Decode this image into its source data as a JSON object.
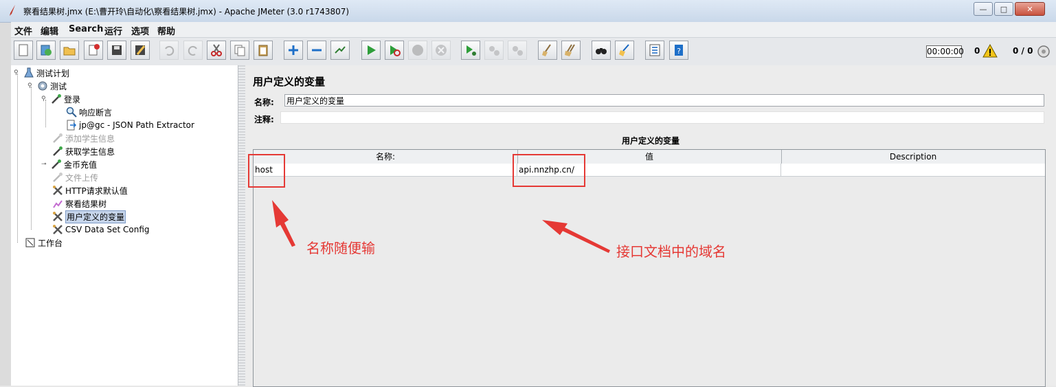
{
  "window": {
    "title": "察看结果树.jmx (E:\\曹开玲\\自动化\\察看结果树.jmx) - Apache JMeter (3.0 r1743807)",
    "buttons": {
      "minimize": "—",
      "maximize": "□",
      "close": "✕"
    }
  },
  "menu": [
    "文件",
    "编辑",
    "Search",
    "运行",
    "选项",
    "帮助"
  ],
  "toolbar": {
    "timer": "00:00:00",
    "warnings": "0",
    "threads": "0 / 0"
  },
  "tree": {
    "items": [
      {
        "label": "测试计划",
        "icon": "flask-icon",
        "enabled": true
      },
      {
        "label": "测试",
        "icon": "gear-icon",
        "enabled": true
      },
      {
        "label": "登录",
        "icon": "sampler-icon",
        "enabled": true
      },
      {
        "label": "响应断言",
        "icon": "magnifier-icon",
        "enabled": true
      },
      {
        "label": "jp@gc - JSON Path Extractor",
        "icon": "extractor-icon",
        "enabled": true
      },
      {
        "label": "添加学生信息",
        "icon": "sampler-icon",
        "enabled": false
      },
      {
        "label": "获取学生信息",
        "icon": "sampler-icon",
        "enabled": true
      },
      {
        "label": "金币充值",
        "icon": "sampler-icon",
        "enabled": true
      },
      {
        "label": "文件上传",
        "icon": "sampler-icon",
        "enabled": false
      },
      {
        "label": "HTTP请求默认值",
        "icon": "wrench-icon",
        "enabled": true
      },
      {
        "label": "察看结果树",
        "icon": "listener-icon",
        "enabled": true
      },
      {
        "label": "用户定义的变量",
        "icon": "wrench-icon",
        "enabled": true,
        "selected": true
      },
      {
        "label": "CSV Data Set Config",
        "icon": "wrench-icon",
        "enabled": true
      },
      {
        "label": "工作台",
        "icon": "workbench-icon",
        "enabled": true
      }
    ]
  },
  "panel": {
    "title": "用户定义的变量",
    "name_label": "名称:",
    "name_value": "用户定义的变量",
    "comment_label": "注释:",
    "comment_value": "",
    "table_title": "用户定义的变量",
    "columns": [
      "名称:",
      "值",
      "Description"
    ],
    "rows": [
      {
        "name": "host",
        "value": "api.nnzhp.cn/",
        "description": ""
      }
    ]
  },
  "annotations": {
    "left": "名称随便输",
    "right": "接口文档中的域名",
    "color": "#e53935"
  }
}
